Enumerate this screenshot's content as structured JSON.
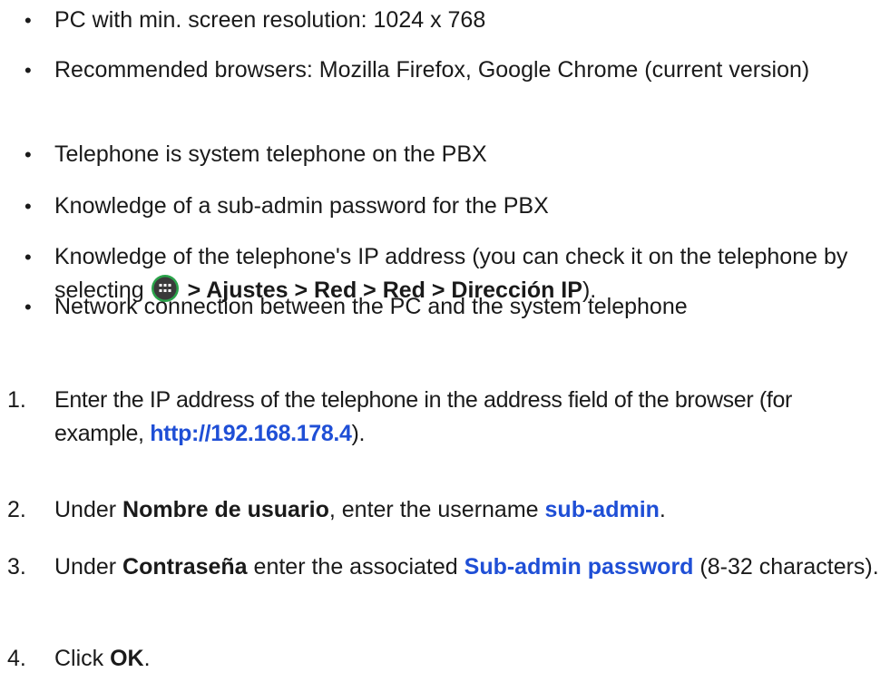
{
  "requirements": [
    "PC with min. screen resolution: 1024 x 768",
    "Recommended browsers: Mozilla Firefox, Google Chrome (current version)",
    "Telephone is system telephone on the PBX",
    "Knowledge of a sub-admin password for the PBX",
    {
      "before": "Knowledge of the telephone's IP address (you can check it on the telephone by selecting ",
      "icon": "apps-menu-icon",
      "path": " > Ajustes > Red > Red > Dirección IP",
      "after": ")."
    },
    "Network connection between the PC and the system telephone"
  ],
  "bullet_char": "•",
  "steps": [
    {
      "number": "1.",
      "text_a": "Enter the IP address of the telephone in the address field of the browser (for example, ",
      "link": "http://192.168.178.4",
      "text_b": ")."
    },
    {
      "number": "2.",
      "text_a": "Under ",
      "bold": "Nombre de usuario",
      "text_b": ", enter the username ",
      "link": "sub-admin",
      "text_c": "."
    },
    {
      "number": "3.",
      "text_a": "Under ",
      "bold": "Contraseña",
      "text_b": " enter the associated ",
      "link": "Sub-admin password",
      "text_c": " (8-32 characters)."
    },
    {
      "number": "4.",
      "text_a": "Click ",
      "bold": "OK",
      "text_b": "."
    }
  ],
  "colors": {
    "text": "#1a1a1a",
    "link": "#1f4fd6",
    "icon_bg": "#3a3a3a",
    "icon_ring": "#2aa34a"
  }
}
